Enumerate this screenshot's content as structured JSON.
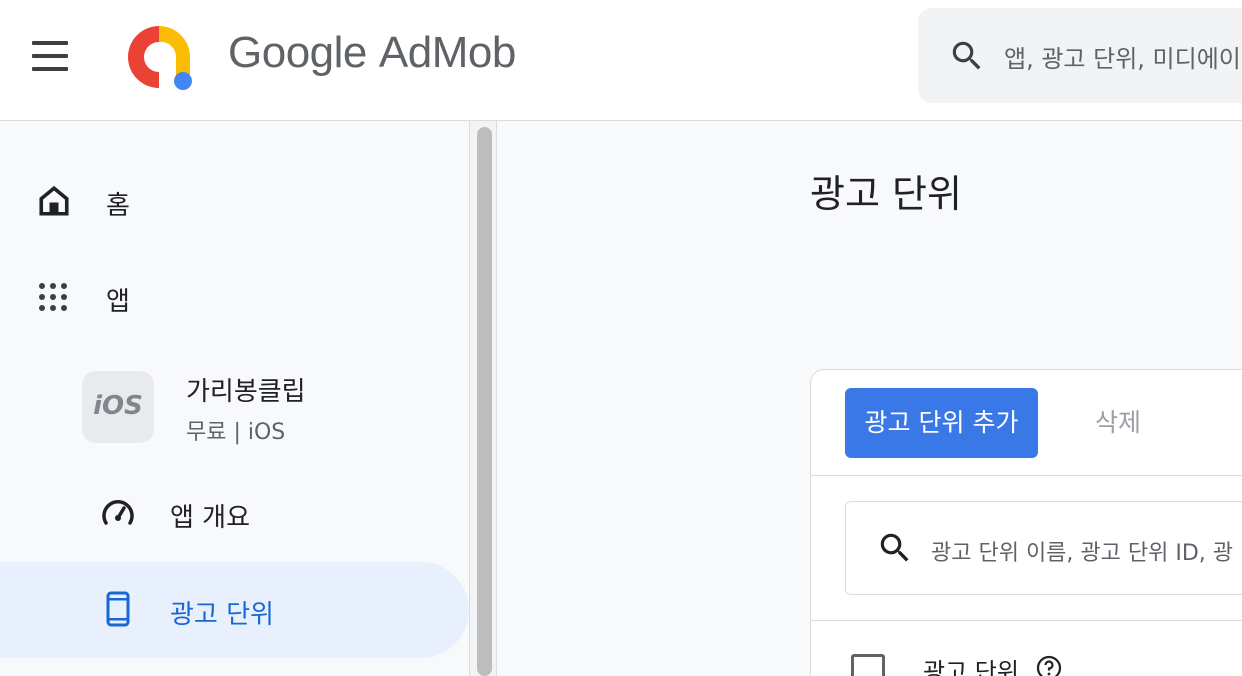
{
  "header": {
    "brand_google": "Google",
    "brand_product": "AdMob",
    "search_placeholder": "앱, 광고 단위, 미디에이"
  },
  "sidebar": {
    "home_label": "홈",
    "apps_label": "앱",
    "app": {
      "platform_badge": "iOS",
      "name": "가리봉클립",
      "subtitle": "무료 | iOS"
    },
    "overview_label": "앱 개요",
    "ad_units_label": "광고 단위"
  },
  "main": {
    "title": "광고 단위",
    "add_button": "광고 단위 추가",
    "delete_button": "삭제",
    "search_placeholder": "광고 단위 이름, 광고 단위 ID, 광",
    "column_header": "광고 단위"
  },
  "colors": {
    "accent": "#3b78e7",
    "active_nav_bg": "#e8f0fe",
    "active_nav_text": "#1967d2"
  }
}
